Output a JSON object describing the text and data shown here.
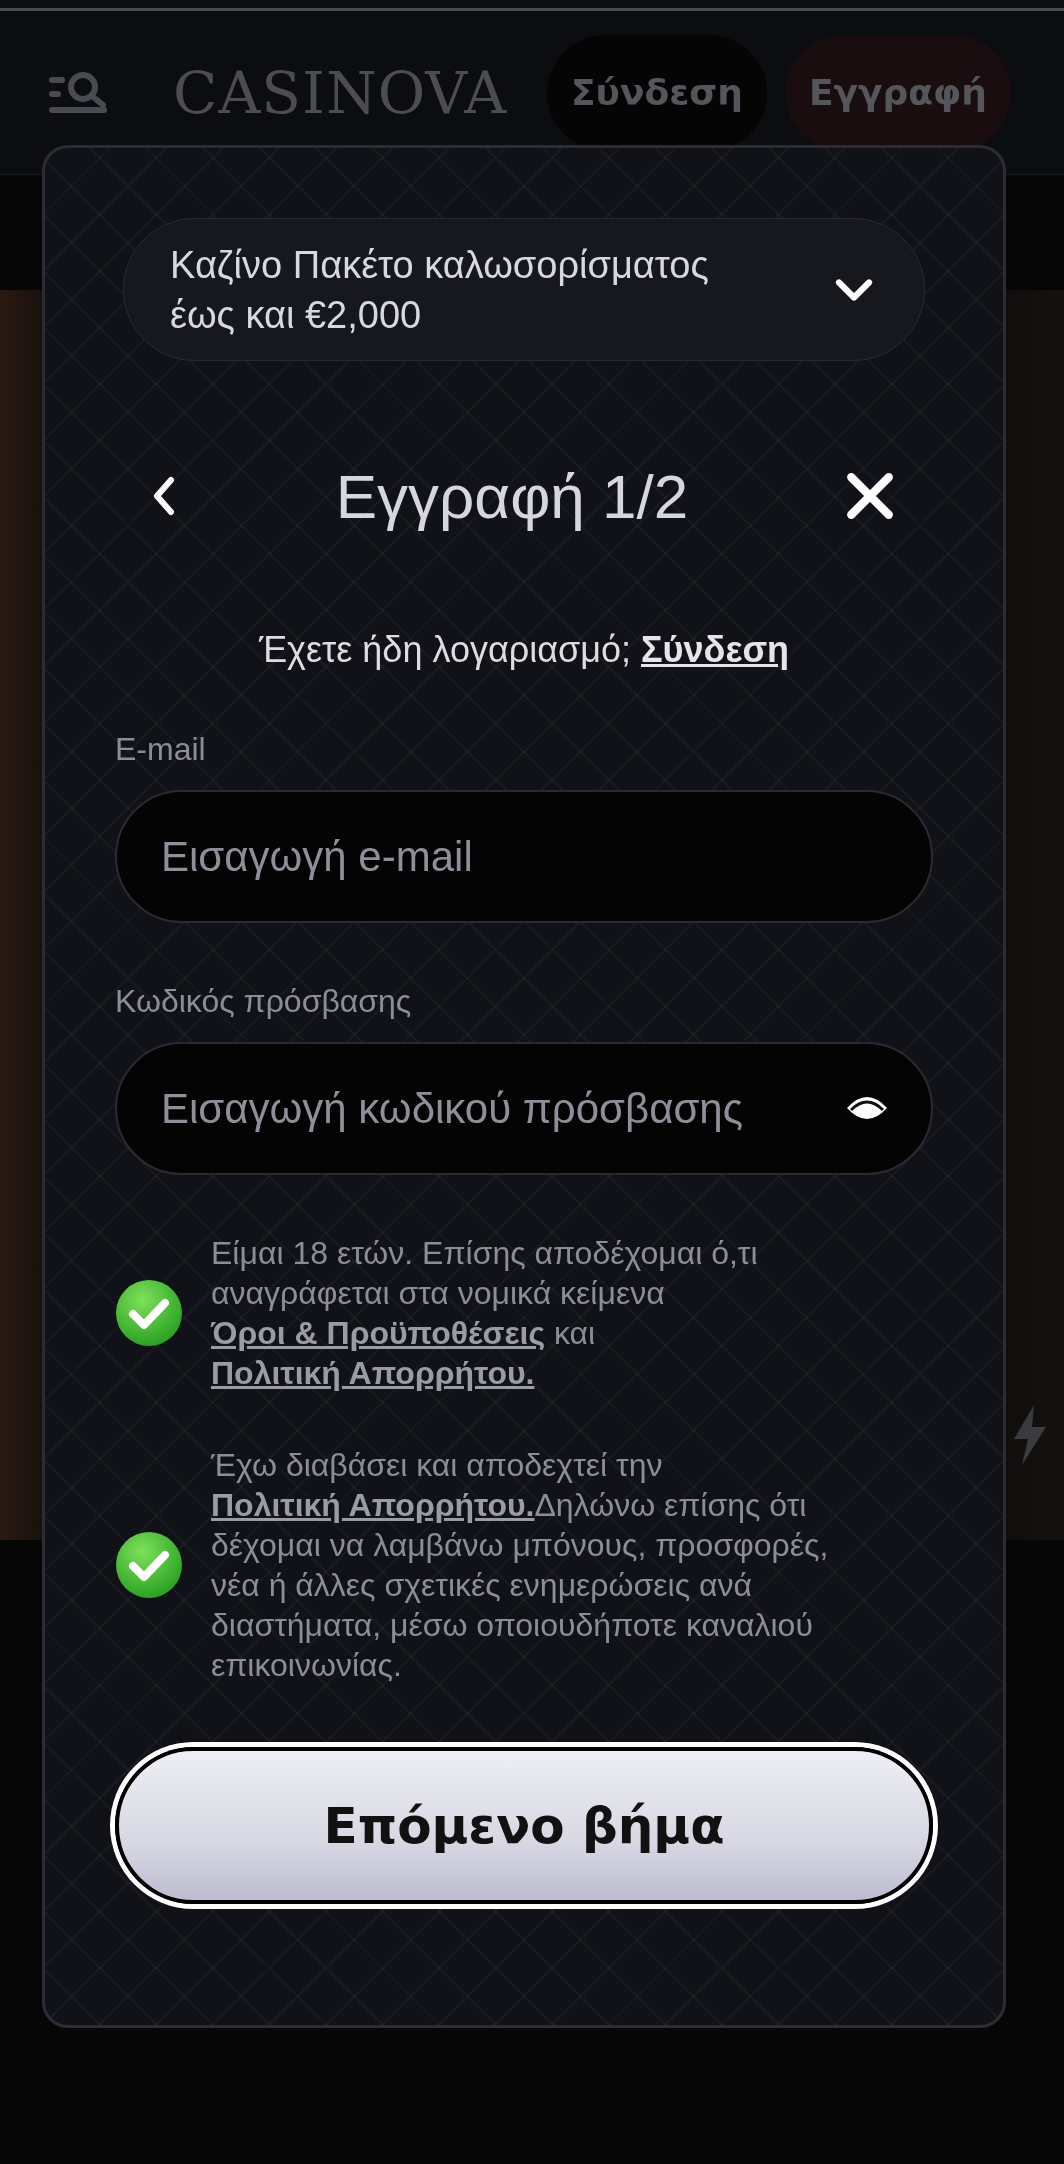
{
  "header": {
    "logo": "CASINOVA",
    "buttons": [
      {
        "label": "Σύνδεση",
        "kind": "login"
      },
      {
        "label": "Εγγραφή",
        "kind": "register"
      }
    ]
  },
  "modal": {
    "promo": {
      "text": "Καζίνο Πακέτο καλωσορίσματος έως και €2,000",
      "expanded": false
    },
    "title": "Εγγραφή 1/2",
    "login_prompt": {
      "text": "Έχετε ήδη λογαριασμό;",
      "link": "Σύνδεση"
    },
    "fields": [
      {
        "label": "E-mail",
        "placeholder": "Εισαγωγή e-mail",
        "kind": "email"
      },
      {
        "label": "Κωδικός πρόσβασης",
        "placeholder": "Εισαγωγή κωδικού πρόσβασης",
        "kind": "password"
      }
    ],
    "consents": [
      {
        "checked": true,
        "parts": [
          {
            "kind": "text",
            "text": "Είμαι 18 ετών. Επίσης αποδέχομαι ό,τι αναγράφεται στα νομικά κείμενα "
          },
          {
            "kind": "link",
            "text": "Όροι & Προϋποθέσεις"
          },
          {
            "kind": "text",
            "text": " και "
          },
          {
            "kind": "link",
            "text": "Πολιτική Απορρήτου."
          }
        ]
      },
      {
        "checked": true,
        "parts": [
          {
            "kind": "text",
            "text": "Έχω διαβάσει και αποδεχτεί την "
          },
          {
            "kind": "link",
            "text": "Πολιτική Απορρήτου."
          },
          {
            "kind": "text",
            "text": "Δηλώνω επίσης ότι δέχομαι να λαμβάνω μπόνους, προσφορές, νέα ή άλλες σχετικές ενημερώσεις ανά διαστήματα, μέσω οποιουδήποτε καναλιού επικοινωνίας."
          }
        ]
      }
    ],
    "submit": "Επόμενο βήμα"
  }
}
